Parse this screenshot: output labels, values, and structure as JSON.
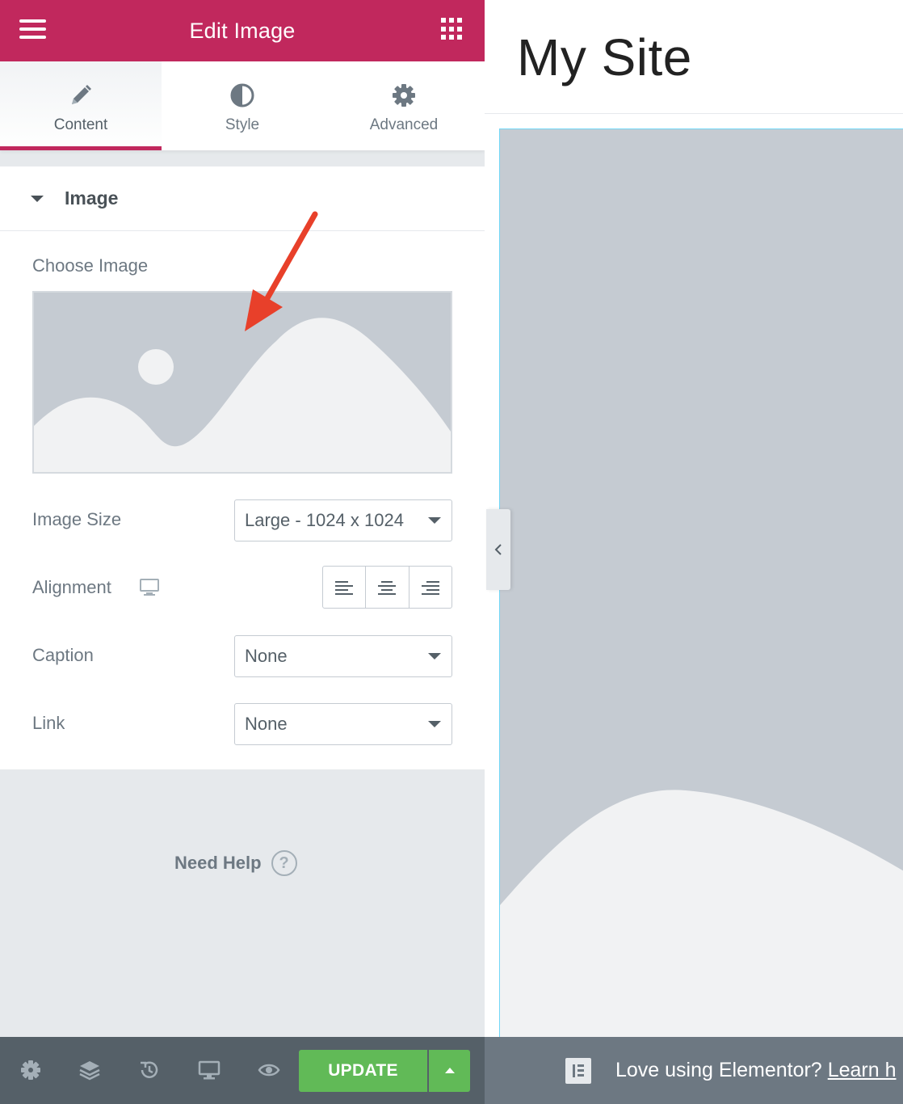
{
  "panel": {
    "title": "Edit Image",
    "tabs": [
      {
        "label": "Content",
        "icon": "pencil-icon",
        "active": true
      },
      {
        "label": "Style",
        "icon": "contrast-icon",
        "active": false
      },
      {
        "label": "Advanced",
        "icon": "gear-icon",
        "active": false
      }
    ],
    "section_title": "Image",
    "choose_image_label": "Choose Image",
    "image_size": {
      "label": "Image Size",
      "value": "Large - 1024 x 1024"
    },
    "alignment": {
      "label": "Alignment",
      "device_icon": "desktop-icon",
      "options": [
        "left",
        "center",
        "right"
      ]
    },
    "caption": {
      "label": "Caption",
      "value": "None"
    },
    "link": {
      "label": "Link",
      "value": "None"
    },
    "help_label": "Need Help",
    "help_icon": "?",
    "update_label": "UPDATE"
  },
  "footer_icons": [
    "settings-icon",
    "navigator-icon",
    "history-icon",
    "responsive-icon",
    "preview-eye-icon"
  ],
  "preview": {
    "site_title": "My Site",
    "notice_text": "Love using Elementor?",
    "notice_link": "Learn h"
  },
  "colors": {
    "brand": "#c1285d",
    "update": "#61ba57",
    "panel_bg": "#e6e9ec",
    "placeholder": "#c5cbd2",
    "annotation_arrow": "#e8402a"
  }
}
